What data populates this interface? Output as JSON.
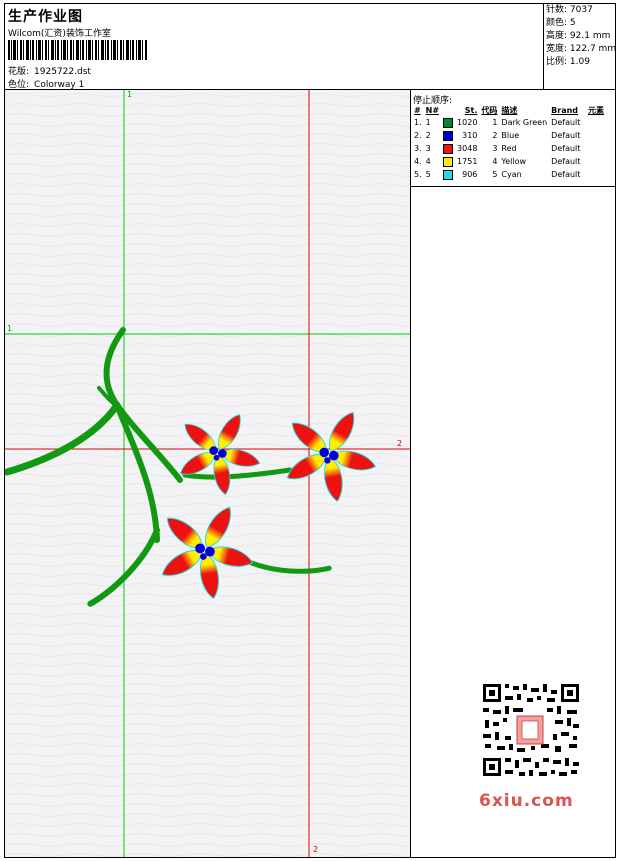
{
  "header": {
    "title": "生产作业图",
    "studio": "Wilcom(汇资)装饰工作室",
    "design_label": "花版:",
    "design_value": "1925722.dst",
    "colorway_label": "色位:",
    "colorway_value": "Colorway 1"
  },
  "specs": [
    {
      "label": "针数:",
      "value": "7037"
    },
    {
      "label": "颜色:",
      "value": "5"
    },
    {
      "label": "高度:",
      "value": "92.1 mm"
    },
    {
      "label": "宽度:",
      "value": "122.7 mm"
    },
    {
      "label": "比例:",
      "value": "1.09"
    }
  ],
  "stop_sequence": {
    "title": "停止顺序:",
    "columns": [
      "#",
      "N#",
      "St.",
      "代码",
      "描述",
      "Brand",
      "元素"
    ],
    "rows": [
      {
        "num": "1.",
        "n": "1",
        "color": "#008a2e",
        "st": "1020",
        "code": "1",
        "desc": "Dark Green",
        "brand": "Default"
      },
      {
        "num": "2.",
        "n": "2",
        "color": "#0000dd",
        "st": "310",
        "code": "2",
        "desc": "Blue",
        "brand": "Default"
      },
      {
        "num": "3.",
        "n": "3",
        "color": "#ee1111",
        "st": "3048",
        "code": "3",
        "desc": "Red",
        "brand": "Default"
      },
      {
        "num": "4.",
        "n": "4",
        "color": "#ffee00",
        "st": "1751",
        "code": "4",
        "desc": "Yellow",
        "brand": "Default"
      },
      {
        "num": "5.",
        "n": "5",
        "color": "#22dddd",
        "st": "906",
        "code": "5",
        "desc": "Cyan",
        "brand": "Default"
      }
    ]
  },
  "guides": {
    "green_v_label": "1",
    "green_h_label": "1",
    "red_h_label": "2",
    "red_v_label": "2"
  },
  "colors": {
    "green_guide": "#00cc00",
    "red_guide": "#dd0000",
    "leaf": "#119911",
    "petal": "#ee1111",
    "petal_tip": "#ffee00",
    "center": "#0000dd",
    "outline": "#22dddd"
  },
  "watermark": "6xiu.com"
}
